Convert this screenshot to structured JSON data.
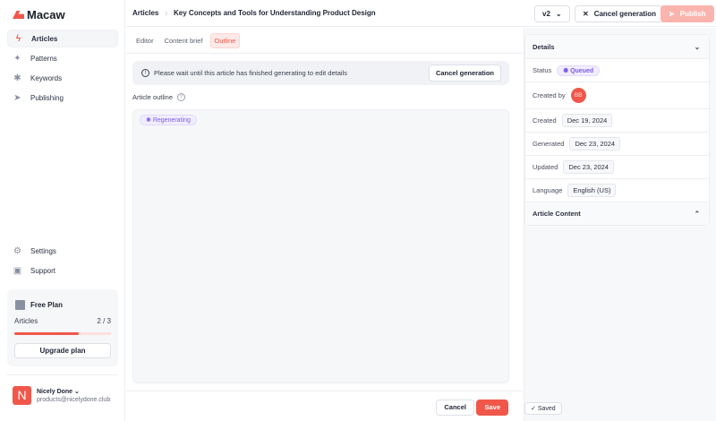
{
  "app": {
    "name": "Macaw"
  },
  "sidebar": {
    "items": [
      {
        "label": "Articles",
        "icon": "bolt-icon"
      },
      {
        "label": "Patterns",
        "icon": "sparkles-icon"
      },
      {
        "label": "Keywords",
        "icon": "asterisk-icon"
      },
      {
        "label": "Publishing",
        "icon": "send-icon"
      }
    ],
    "bottom": [
      {
        "label": "Settings",
        "icon": "gear-icon"
      },
      {
        "label": "Support",
        "icon": "support-icon"
      }
    ],
    "plan": {
      "title": "Free Plan",
      "label": "Articles",
      "count": "2 / 3",
      "progress": 0.67,
      "upgrade": "Upgrade plan"
    },
    "user": {
      "initial": "N",
      "name": "Nicely Done",
      "email": "products@nicelydone.club"
    }
  },
  "header": {
    "breadcrumb": [
      "Articles",
      "Key Concepts and Tools for Understanding Product Design"
    ],
    "version": "v2",
    "cancel": "Cancel generation",
    "publish": "Publish"
  },
  "tabs": [
    "Editor",
    "Content brief",
    "Outline"
  ],
  "notice": {
    "text": "Please wait until this article has finished generating to edit details",
    "button": "Cancel generation"
  },
  "outline": {
    "label": "Article outline",
    "status": "Regenerating"
  },
  "footer": {
    "cancel": "Cancel",
    "save": "Save"
  },
  "details": {
    "title": "Details",
    "status_label": "Status",
    "status": "Queued",
    "created_by_label": "Created by",
    "created_by": "BB",
    "created_label": "Created",
    "created": "Dec 19, 2024",
    "generated_label": "Generated",
    "generated": "Dec 23, 2024",
    "updated_label": "Updated",
    "updated": "Dec 23, 2024",
    "language_label": "Language",
    "language": "English (US)",
    "content_title": "Article Content",
    "saved": "Saved"
  }
}
